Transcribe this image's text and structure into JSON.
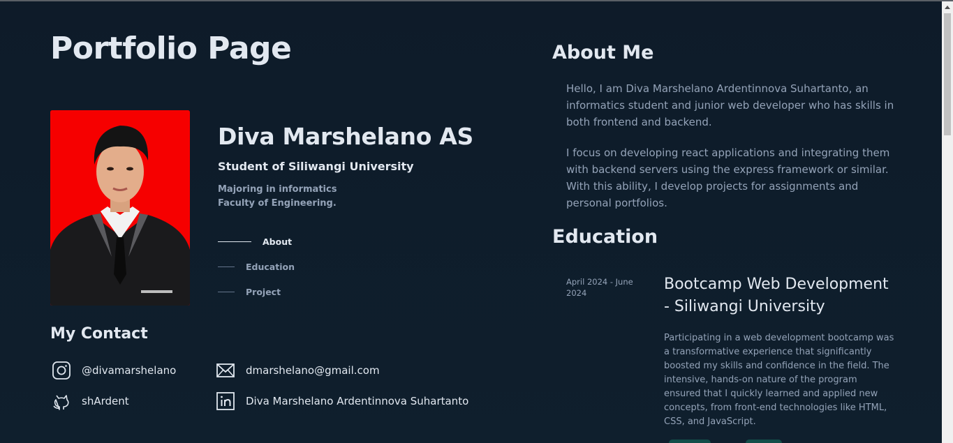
{
  "page": {
    "title": "Portfolio Page"
  },
  "profile": {
    "name": "Diva Marshelano AS",
    "subtitle": "Student of Siliwangi University",
    "desc_line1": "Majoring in informatics",
    "desc_line2": "Faculty of Engineering.",
    "photo_background": "#ff0000"
  },
  "nav": {
    "items": [
      {
        "label": "About",
        "active": true
      },
      {
        "label": "Education",
        "active": false
      },
      {
        "label": "Project",
        "active": false
      }
    ]
  },
  "contact": {
    "title": "My Contact",
    "instagram": "@divamarshelano",
    "email": "dmarshelano@gmail.com",
    "github": "shArdent",
    "linkedin": "Diva Marshelano Ardentinnova Suhartanto"
  },
  "about": {
    "heading": "About Me",
    "paragraph1": "Hello, I am Diva Marshelano Ardentinnova Suhartanto, an informatics student and junior web developer who has skills in both frontend and backend.",
    "paragraph2": "I focus on developing react applications and integrating them with backend servers using the express framework or similar. With this ability, I develop projects for assignments and personal portfolios."
  },
  "education": {
    "heading": "Education",
    "entries": [
      {
        "date": "April 2024 - June 2024",
        "title": "Bootcamp Web Development - Siliwangi University",
        "description": "Participating in a web development bootcamp was a transformative experience that significantly boosted my skills and confidence in the field. The intensive, hands-on nature of the program ensured that I quickly learned and applied new concepts, from front-end technologies like HTML, CSS, and JavaScript."
      }
    ]
  },
  "colors": {
    "background": "#0f1c2a",
    "heading": "#e2e8f0",
    "muted": "#94a3b8"
  }
}
